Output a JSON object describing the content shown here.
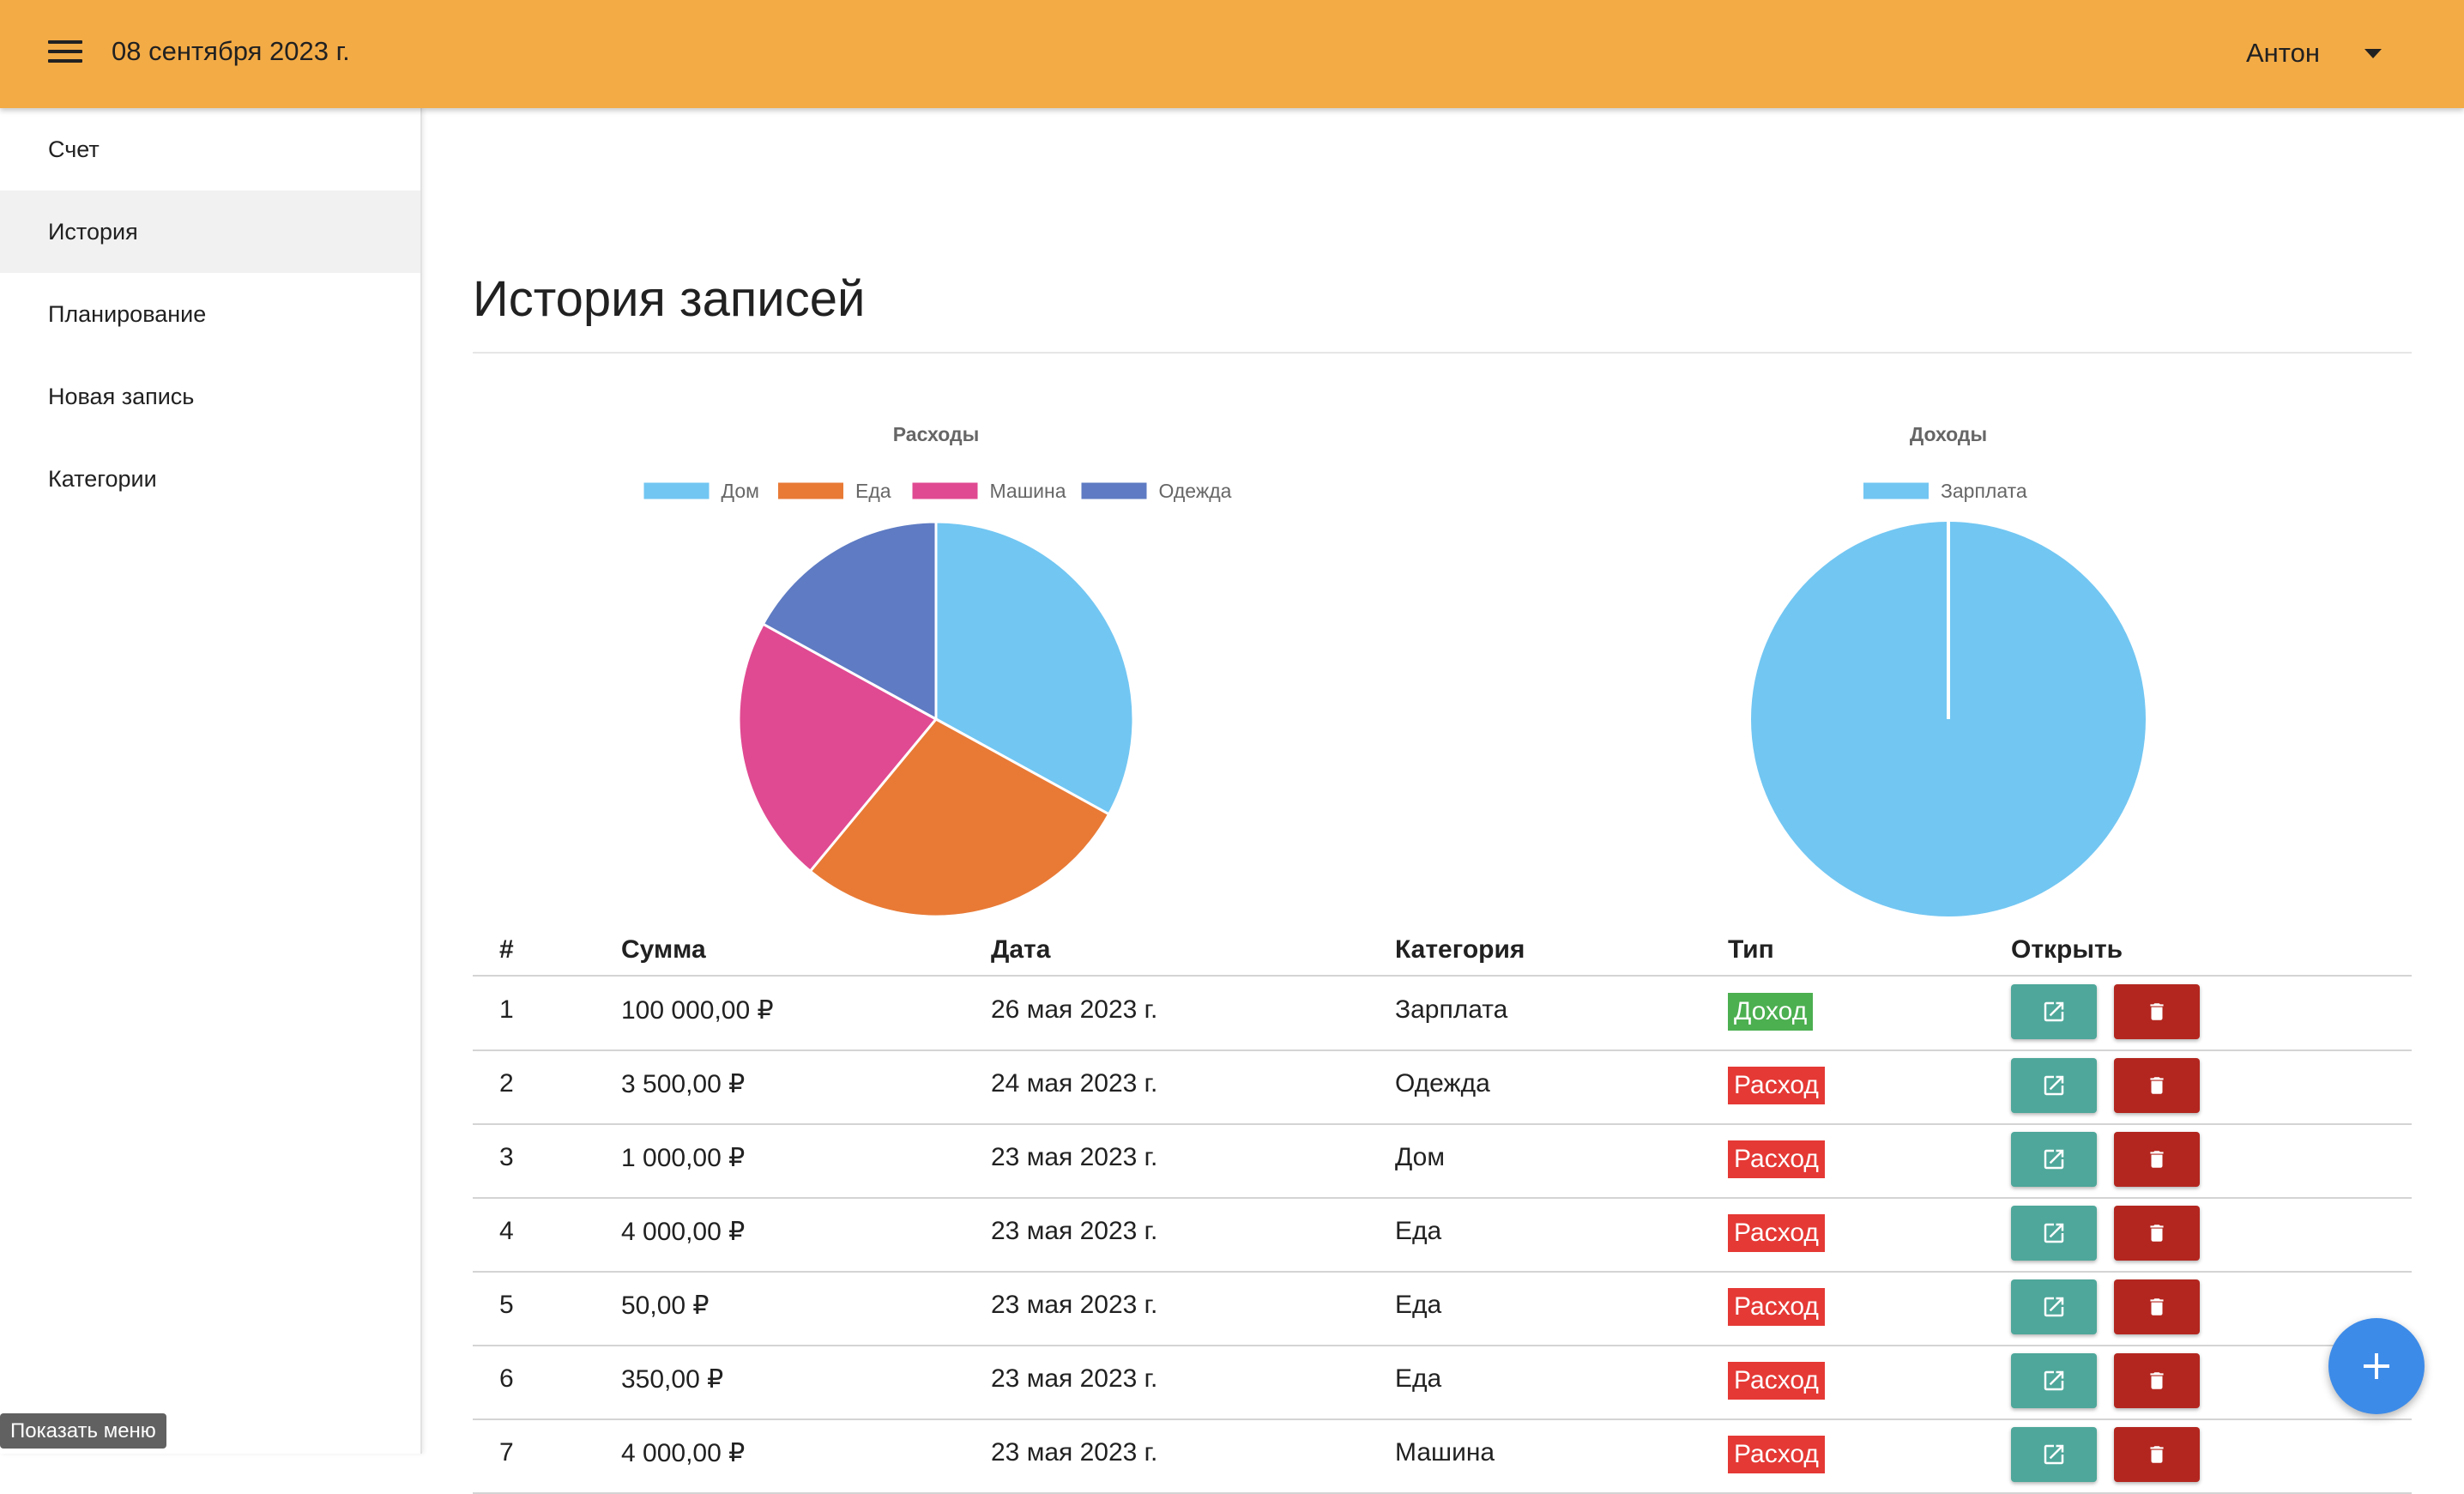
{
  "topbar": {
    "date": "08 сентября 2023 г.",
    "user_name": "Антон",
    "icons": {
      "menu": "hamburger-menu-icon",
      "dropdown": "caret-down-icon"
    },
    "color": "#f3ab46"
  },
  "sidebar": {
    "items": [
      {
        "label": "Счет",
        "active": false
      },
      {
        "label": "История",
        "active": true
      },
      {
        "label": "Планирование",
        "active": false
      },
      {
        "label": "Новая запись",
        "active": false
      },
      {
        "label": "Категории",
        "active": false
      }
    ]
  },
  "main": {
    "title": "История записей"
  },
  "chart_data": [
    {
      "type": "pie",
      "title": "Расходы",
      "legend_position": "top",
      "categories": [
        "Дом",
        "Еда",
        "Машина",
        "Одежда"
      ],
      "values": [
        33,
        28,
        22,
        17
      ],
      "colors": [
        "#72c6f2",
        "#e87a36",
        "#e04a92",
        "#5e7bc3"
      ]
    },
    {
      "type": "pie",
      "title": "Доходы",
      "legend_position": "top",
      "categories": [
        "Зарплата"
      ],
      "values": [
        100000
      ],
      "colors": [
        "#72c6f2"
      ]
    }
  ],
  "table": {
    "columns": [
      "#",
      "Сумма",
      "Дата",
      "Категория",
      "Тип",
      "Открыть"
    ],
    "rows": [
      {
        "num": "1",
        "amount": "100 000,00 ₽",
        "date": "26 мая 2023 г.",
        "category": "Зарплата",
        "type": "Доход",
        "kind": "income"
      },
      {
        "num": "2",
        "amount": "3 500,00 ₽",
        "date": "24 мая 2023 г.",
        "category": "Одежда",
        "type": "Расход",
        "kind": "expense"
      },
      {
        "num": "3",
        "amount": "1 000,00 ₽",
        "date": "23 мая 2023 г.",
        "category": "Дом",
        "type": "Расход",
        "kind": "expense"
      },
      {
        "num": "4",
        "amount": "4 000,00 ₽",
        "date": "23 мая 2023 г.",
        "category": "Еда",
        "type": "Расход",
        "kind": "expense"
      },
      {
        "num": "5",
        "amount": "50,00 ₽",
        "date": "23 мая 2023 г.",
        "category": "Еда",
        "type": "Расход",
        "kind": "expense"
      },
      {
        "num": "6",
        "amount": "350,00 ₽",
        "date": "23 мая 2023 г.",
        "category": "Еда",
        "type": "Расход",
        "kind": "expense"
      },
      {
        "num": "7",
        "amount": "4 000,00 ₽",
        "date": "23 мая 2023 г.",
        "category": "Машина",
        "type": "Расход",
        "kind": "expense"
      }
    ],
    "icons": {
      "open": "open-external-icon",
      "delete": "trash-icon"
    },
    "colors": {
      "income": "#4caf50",
      "expense": "#e53935",
      "open_button": "#4ea79a",
      "delete_button": "#b3261f"
    }
  },
  "fab": {
    "icon": "plus-icon",
    "color": "#3d8be8"
  },
  "tooltip": {
    "text": "Показать меню"
  }
}
